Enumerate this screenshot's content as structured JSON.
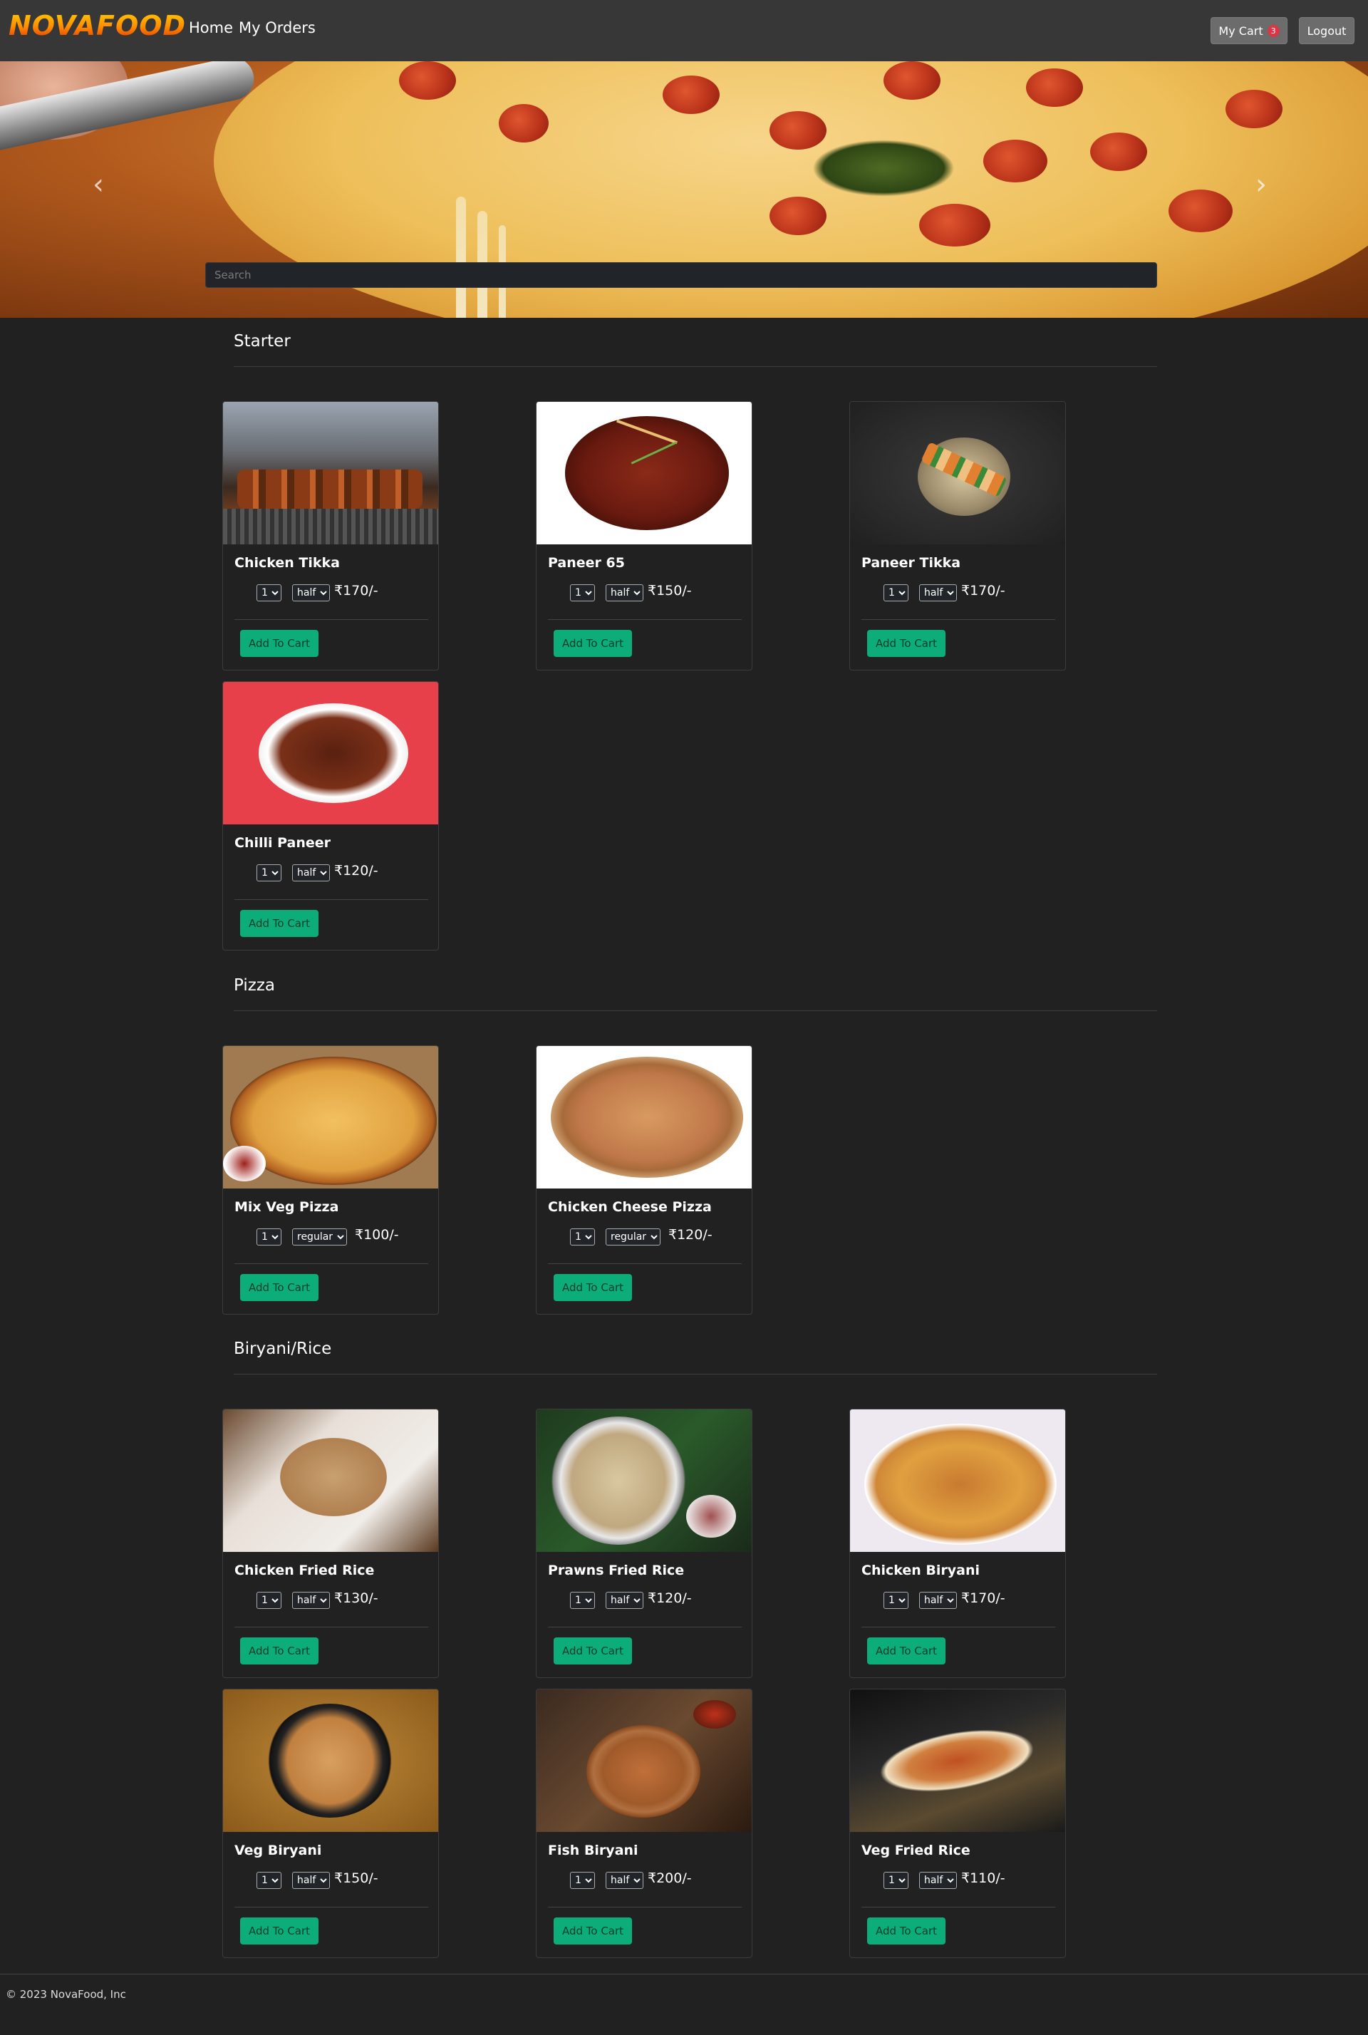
{
  "navbar": {
    "brand": "NOVAFOOD",
    "links": {
      "home": "Home",
      "orders": "My Orders"
    },
    "cart_label": "My Cart",
    "cart_count": "3",
    "logout_label": "Logout"
  },
  "hero": {
    "search_placeholder": "Search",
    "prev_arrow": "‹",
    "next_arrow": "›"
  },
  "sections": {
    "starter": "Starter",
    "pizza": "Pizza",
    "biryani": "Biryani/Rice"
  },
  "items": [
    {
      "name": "Chicken Tikka",
      "qty": "1",
      "size": "half",
      "price": "₹170/-"
    },
    {
      "name": "Paneer 65",
      "qty": "1",
      "size": "half",
      "price": "₹150/-"
    },
    {
      "name": "Paneer Tikka",
      "qty": "1",
      "size": "half",
      "price": "₹170/-"
    },
    {
      "name": "Chilli Paneer",
      "qty": "1",
      "size": "half",
      "price": "₹120/-"
    },
    {
      "name": "Mix Veg Pizza",
      "qty": "1",
      "size": "regular",
      "price": "₹100/-"
    },
    {
      "name": "Chicken Cheese Pizza",
      "qty": "1",
      "size": "regular",
      "price": "₹120/-"
    },
    {
      "name": "Chicken Fried Rice",
      "qty": "1",
      "size": "half",
      "price": "₹130/-"
    },
    {
      "name": "Prawns Fried Rice",
      "qty": "1",
      "size": "half",
      "price": "₹120/-"
    },
    {
      "name": "Chicken Biryani",
      "qty": "1",
      "size": "half",
      "price": "₹170/-"
    },
    {
      "name": "Veg Biryani",
      "qty": "1",
      "size": "half",
      "price": "₹150/-"
    },
    {
      "name": "Fish Biryani",
      "qty": "1",
      "size": "half",
      "price": "₹200/-"
    },
    {
      "name": "Veg Fried Rice",
      "qty": "1",
      "size": "half",
      "price": "₹110/-"
    }
  ],
  "add_to_cart_label": "Add To Cart",
  "footer": {
    "text": "© 2023 NovaFood, Inc"
  },
  "colors": {
    "accent": "#0dad7a",
    "navbar": "#373737",
    "background": "#212121",
    "badge": "#dc3545"
  }
}
